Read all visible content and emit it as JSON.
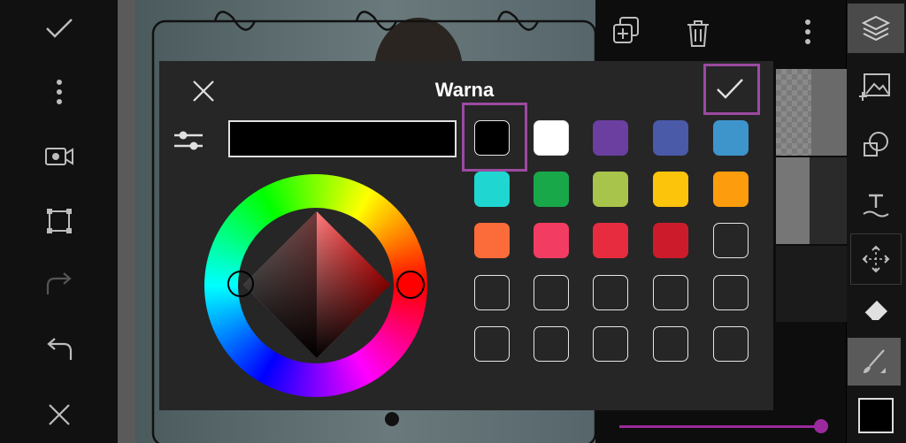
{
  "dialog": {
    "title": "Warna",
    "hex_value": ""
  },
  "swatches": [
    {
      "color": "#000000",
      "selected": true
    },
    {
      "color": "#ffffff"
    },
    {
      "color": "#6a3fa0"
    },
    {
      "color": "#4a5aa8"
    },
    {
      "color": "#3d95cc"
    },
    {
      "color": "#1fd6d0"
    },
    {
      "color": "#18a84a"
    },
    {
      "color": "#a8c44a"
    },
    {
      "color": "#fdc40c"
    },
    {
      "color": "#fd9c0c"
    },
    {
      "color": "#fc6b3a"
    },
    {
      "color": "#f33c62"
    },
    {
      "color": "#e82c40"
    },
    {
      "color": "#cc1c2c"
    },
    {
      "color": "empty"
    },
    {
      "color": "empty"
    },
    {
      "color": "empty"
    },
    {
      "color": "empty"
    },
    {
      "color": "empty"
    },
    {
      "color": "empty"
    },
    {
      "color": "empty"
    },
    {
      "color": "empty"
    },
    {
      "color": "empty"
    },
    {
      "color": "empty"
    },
    {
      "color": "empty"
    }
  ],
  "colors": {
    "highlight": "#9b4aa0",
    "dialog_bg": "#262626",
    "accent": "#9b2a9e"
  },
  "icons": {
    "left_toolbar": [
      "check-icon",
      "more-vertical-icon",
      "camera-icon",
      "crop-icon",
      "redo-icon",
      "undo-icon",
      "close-icon"
    ],
    "right_toolbar": [
      "layers-icon",
      "add-image-layer-icon",
      "shape-icon",
      "text-icon",
      "move-icon",
      "eraser-icon",
      "brush-icon",
      "color-square-icon"
    ],
    "top_panel": [
      "add-layer-icon",
      "trash-icon",
      "more-vertical-icon"
    ]
  }
}
